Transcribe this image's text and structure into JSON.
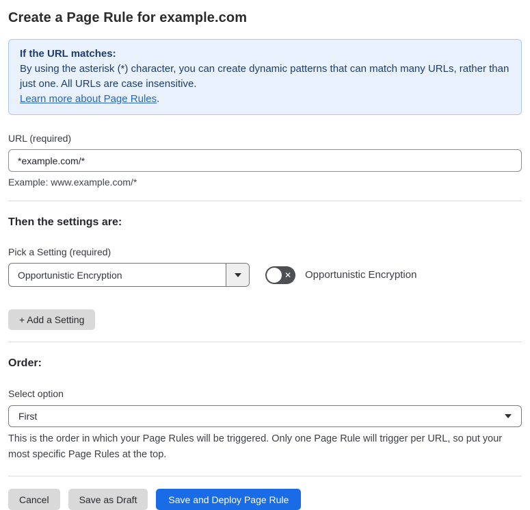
{
  "page": {
    "title": "Create a Page Rule for example.com"
  },
  "info_box": {
    "heading": "If the URL matches:",
    "body": "By using the asterisk (*) character, you can create dynamic patterns that can match many URLs, rather than just one. All URLs are case insensitive.",
    "link_label": "Learn more about Page Rules",
    "link_suffix": "."
  },
  "url_field": {
    "label": "URL (required)",
    "value": "*example.com/*",
    "helper": "Example: www.example.com/*"
  },
  "settings": {
    "heading": "Then the settings are:",
    "picker_label": "Pick a Setting (required)",
    "selected_setting": "Opportunistic Encryption",
    "toggle_state": "off",
    "toggle_off_glyph": "✕",
    "toggle_label": "Opportunistic Encryption",
    "add_button_label": "+ Add a Setting"
  },
  "order": {
    "heading": "Order:",
    "label": "Select option",
    "selected_option": "First",
    "helper": "This is the order in which your Page Rules will be triggered. Only one Page Rule will trigger per URL, so put your most specific Page Rules at the top."
  },
  "footer": {
    "cancel_label": "Cancel",
    "save_draft_label": "Save as Draft",
    "save_deploy_label": "Save and Deploy Page Rule"
  },
  "colors": {
    "info_bg": "#e9f2fc",
    "info_border": "#a9c9ee",
    "info_text": "#1d3c6e",
    "link": "#2565c7",
    "primary_button": "#1a6ce6",
    "toggle_off_bg": "#4d4f52",
    "gray_button_bg": "#d9d9d9"
  }
}
